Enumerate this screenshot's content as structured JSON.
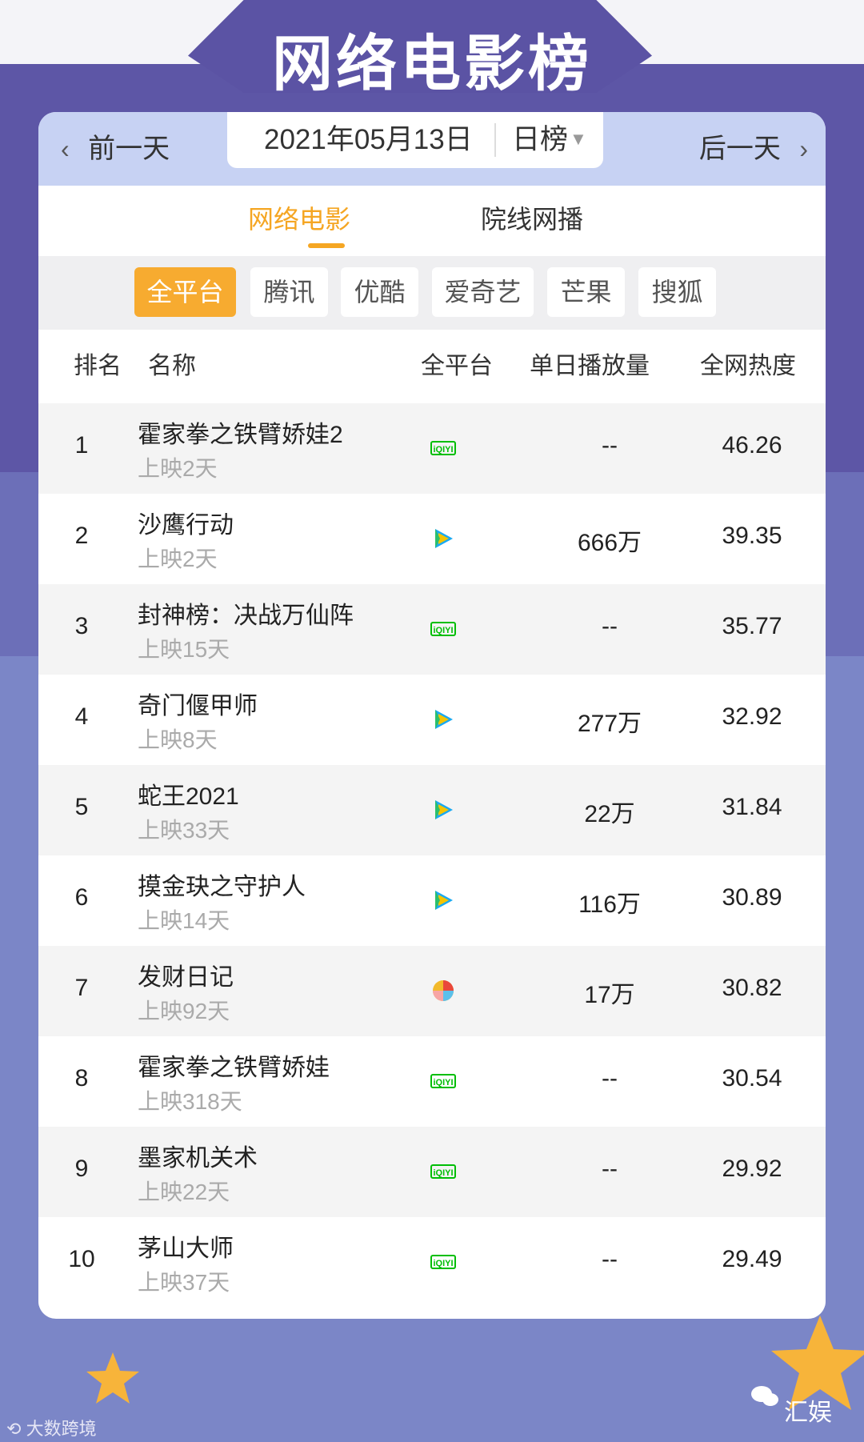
{
  "page": {
    "title": "网络电影榜",
    "watermark_left": "大数跨境",
    "watermark_right": "汇娱"
  },
  "datebar": {
    "prev_label": "前一天",
    "next_label": "后一天",
    "date": "2021年05月13日",
    "period": "日榜"
  },
  "tabs": [
    {
      "label": "网络电影",
      "active": true
    },
    {
      "label": "院线网播",
      "active": false
    }
  ],
  "platforms": [
    {
      "label": "全平台",
      "active": true
    },
    {
      "label": "腾讯",
      "active": false
    },
    {
      "label": "优酷",
      "active": false
    },
    {
      "label": "爱奇艺",
      "active": false
    },
    {
      "label": "芒果",
      "active": false
    },
    {
      "label": "搜狐",
      "active": false
    }
  ],
  "table": {
    "headers": {
      "rank": "排名",
      "name": "名称",
      "platform": "全平台",
      "plays": "单日播放量",
      "heat": "全网热度"
    },
    "rows": [
      {
        "rank": "1",
        "name": "霍家拳之铁臂娇娃2",
        "days": "上映2天",
        "platform_icon": "iqiyi-icon",
        "plays": "--",
        "heat": "46.26"
      },
      {
        "rank": "2",
        "name": "沙鹰行动",
        "days": "上映2天",
        "platform_icon": "tencent-video-icon",
        "plays": "666万",
        "heat": "39.35"
      },
      {
        "rank": "3",
        "name": "封神榜：决战万仙阵",
        "days": "上映15天",
        "platform_icon": "iqiyi-icon",
        "plays": "--",
        "heat": "35.77"
      },
      {
        "rank": "4",
        "name": "奇门偃甲师",
        "days": "上映8天",
        "platform_icon": "tencent-video-icon",
        "plays": "277万",
        "heat": "32.92"
      },
      {
        "rank": "5",
        "name": "蛇王2021",
        "days": "上映33天",
        "platform_icon": "tencent-video-icon",
        "plays": "22万",
        "heat": "31.84"
      },
      {
        "rank": "6",
        "name": "摸金玦之守护人",
        "days": "上映14天",
        "platform_icon": "tencent-video-icon",
        "plays": "116万",
        "heat": "30.89"
      },
      {
        "rank": "7",
        "name": "发财日记",
        "days": "上映92天",
        "platform_icon": "multi-platform-icon",
        "plays": "17万",
        "heat": "30.82"
      },
      {
        "rank": "8",
        "name": "霍家拳之铁臂娇娃",
        "days": "上映318天",
        "platform_icon": "iqiyi-icon",
        "plays": "--",
        "heat": "30.54"
      },
      {
        "rank": "9",
        "name": "墨家机关术",
        "days": "上映22天",
        "platform_icon": "iqiyi-icon",
        "plays": "--",
        "heat": "29.92"
      },
      {
        "rank": "10",
        "name": "茅山大师",
        "days": "上映37天",
        "platform_icon": "iqiyi-icon",
        "plays": "--",
        "heat": "29.49"
      }
    ]
  },
  "colors": {
    "accent": "#f5a623",
    "header_purple": "#5b53a4",
    "iqiyi_green": "#00be06",
    "tencent_blue": "#1aa9f2"
  }
}
